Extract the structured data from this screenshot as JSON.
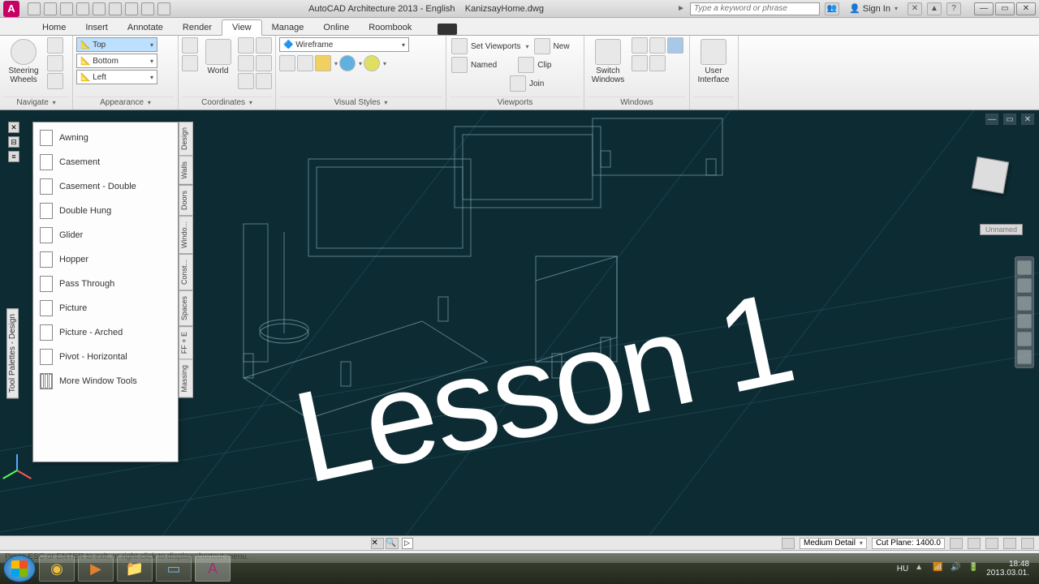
{
  "title": {
    "app": "AutoCAD Architecture 2013 - English",
    "file": "KanizsayHome.dwg"
  },
  "search": {
    "placeholder": "Type a keyword or phrase"
  },
  "signin": "Sign In",
  "tabs": {
    "home": "Home",
    "insert": "Insert",
    "annotate": "Annotate",
    "render": "Render",
    "view": "View",
    "manage": "Manage",
    "online": "Online",
    "roombook": "Roombook"
  },
  "ribbon": {
    "navigate": {
      "steering": "Steering\nWheels",
      "label": "Navigate"
    },
    "appearance": {
      "top": "Top",
      "bottom": "Bottom",
      "left": "Left",
      "world": "World",
      "wireframe": "Wireframe",
      "label_app": "Appearance",
      "label_coord": "Coordinates",
      "label_vs": "Visual Styles"
    },
    "viewports": {
      "set": "Set Viewports",
      "named": "Named",
      "new": "New",
      "clip": "Clip",
      "join": "Join",
      "label": "Viewports"
    },
    "windows": {
      "switch": "Switch\nWindows",
      "label": "Windows"
    },
    "ui": {
      "user": "User\nInterface"
    }
  },
  "palette": {
    "title": "Tool Palettes - Design",
    "items": [
      "Awning",
      "Casement",
      "Casement - Double",
      "Double Hung",
      "Glider",
      "Hopper",
      "Pass Through",
      "Picture",
      "Picture - Arched",
      "Pivot - Horizontal",
      "More Window Tools"
    ],
    "sidetabs": [
      "Design",
      "Walls",
      "Doors",
      "Windo...",
      "Const...",
      "Spaces",
      "FF + E",
      "Massing"
    ]
  },
  "viewcube": {
    "label": "Unnamed"
  },
  "overlay": "Lesson 1",
  "status": {
    "hint": "Press ESC or ENTER to exit, or right-click to display shortcut-menu.",
    "detail": "Medium Detail",
    "cutplane": "Cut Plane: 1400.0"
  },
  "taskbar": {
    "lang": "HU",
    "time": "18:48",
    "date": "2013.03.01."
  }
}
